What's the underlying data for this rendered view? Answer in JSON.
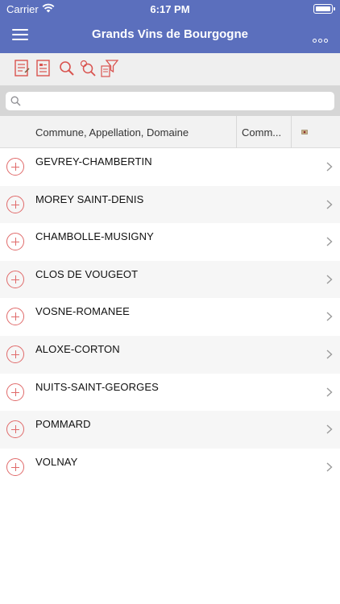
{
  "status": {
    "carrier": "Carrier",
    "time": "6:17 PM"
  },
  "nav": {
    "title": "Grands Vins de Bourgogne"
  },
  "toolbar": {
    "icons": [
      "list-edit-icon",
      "list-view-icon",
      "search-icon",
      "advanced-search-icon",
      "filter-icon"
    ]
  },
  "search": {
    "placeholder": "",
    "value": ""
  },
  "columns": {
    "col1": "Commune, Appellation, Domaine",
    "col2": "Comm..."
  },
  "colors": {
    "nav": "#5b6fbd",
    "accent": "#e06a6a"
  },
  "rows": [
    "GEVREY-CHAMBERTIN",
    "MOREY SAINT-DENIS",
    "CHAMBOLLE-MUSIGNY",
    "CLOS DE VOUGEOT",
    "VOSNE-ROMANEE",
    "ALOXE-CORTON",
    "NUITS-SAINT-GEORGES",
    "POMMARD",
    "VOLNAY"
  ]
}
